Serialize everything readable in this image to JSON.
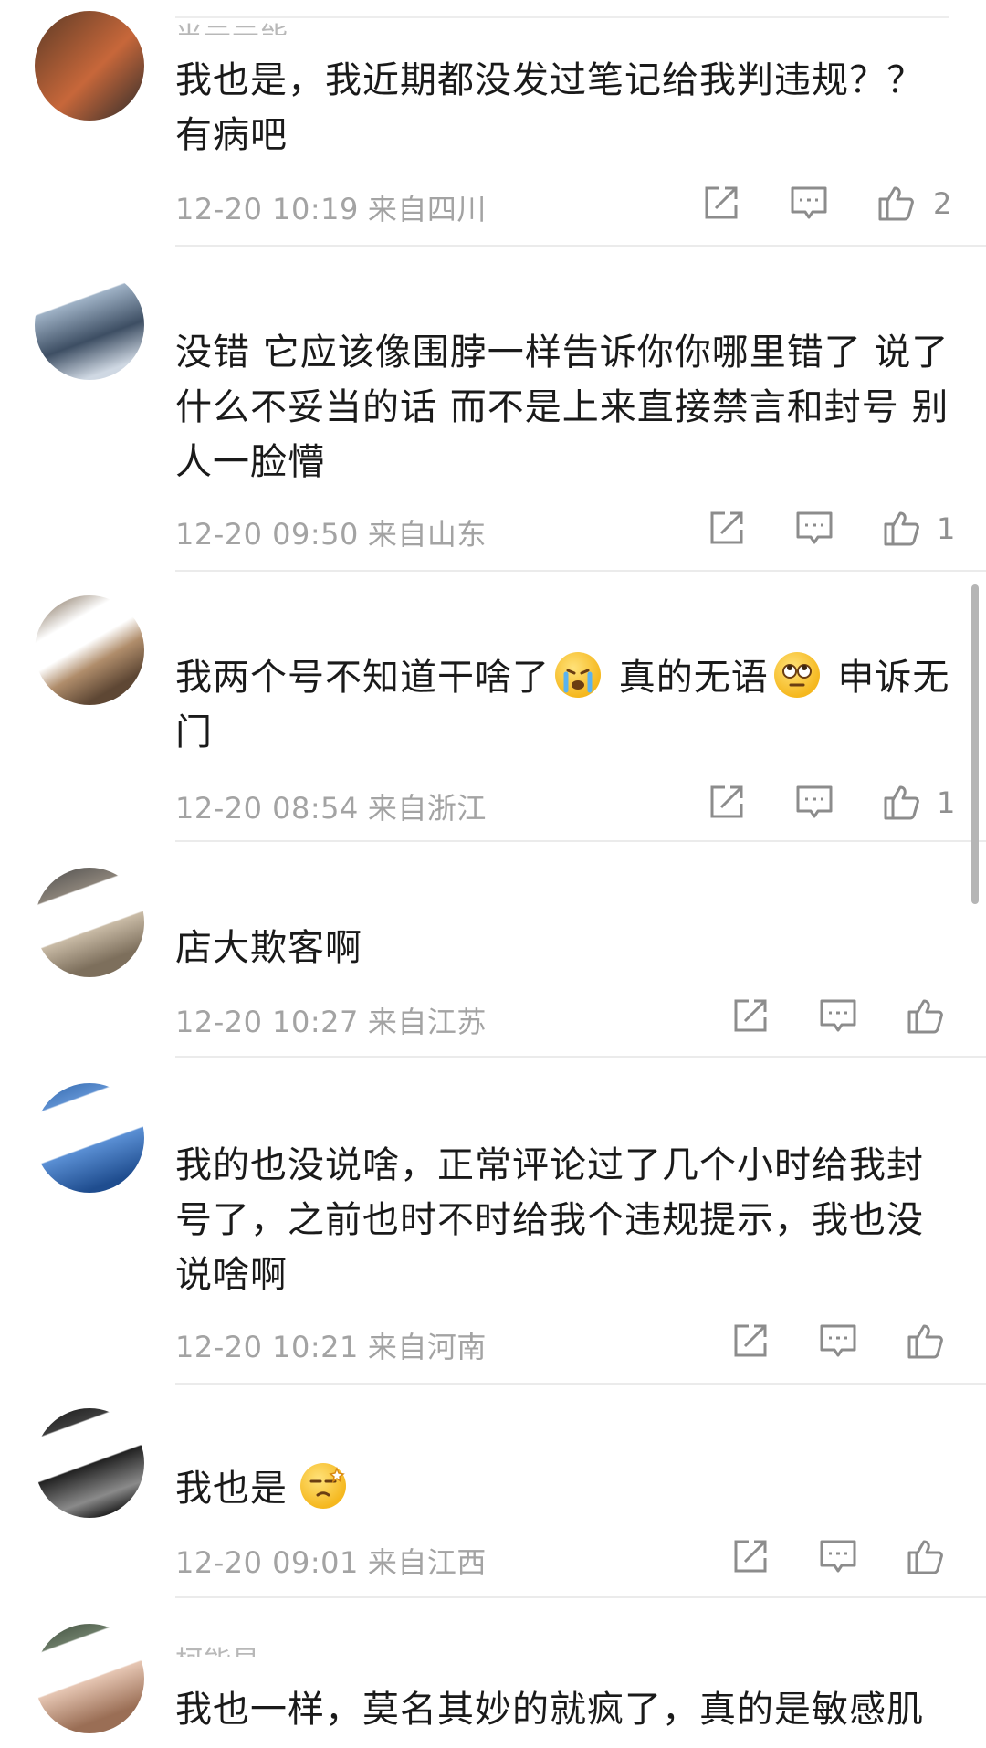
{
  "comments": [
    {
      "username": "当云云能",
      "text": "我也是，我近期都没发过笔记给我判违规？？有病吧",
      "date": "12-20 10:19",
      "location": "来自四川",
      "likes": "2"
    },
    {
      "username": "",
      "text": "没错 它应该像围脖一样告诉你你哪里错了 说了什么不妥当的话 而不是上来直接禁言和封号 别人一脸懵",
      "date": "12-20 09:50",
      "location": "来自山东",
      "likes": "1"
    },
    {
      "username": "",
      "text_before_emoji_1": "我两个号不知道干啥了",
      "text_between_emojis": " 真的无语",
      "text_after_emoji_2": " 申诉无门",
      "emoji_1": "crying-face-emoji",
      "emoji_2": "eye-roll-emoji",
      "date": "12-20 08:54",
      "location": "来自浙江",
      "likes": "1"
    },
    {
      "username": "",
      "text": "店大欺客啊",
      "date": "12-20 10:27",
      "location": "来自江苏",
      "likes": ""
    },
    {
      "username": "",
      "text": "我的也没说啥，正常评论过了几个小时给我封号了，之前也时不时给我个违规提示，我也没说啥啊",
      "date": "12-20 10:21",
      "location": "来自河南",
      "likes": ""
    },
    {
      "username": "",
      "text": "我也是",
      "emoji": "dizzy-face-emoji",
      "date": "12-20 09:01",
      "location": "来自江西",
      "likes": ""
    },
    {
      "username": "柯能显",
      "text": "我也一样，莫名其妙的就疯了，真的是敏感肌",
      "date": "",
      "location": "",
      "likes": ""
    }
  ],
  "icons": {
    "share": "share-icon",
    "reply": "reply-icon",
    "like": "thumbs-up-icon"
  },
  "colors": {
    "text": "#1a1a1a",
    "meta": "#a3a3a3",
    "divider": "#ebebeb",
    "icon": "#8c8c8c"
  }
}
